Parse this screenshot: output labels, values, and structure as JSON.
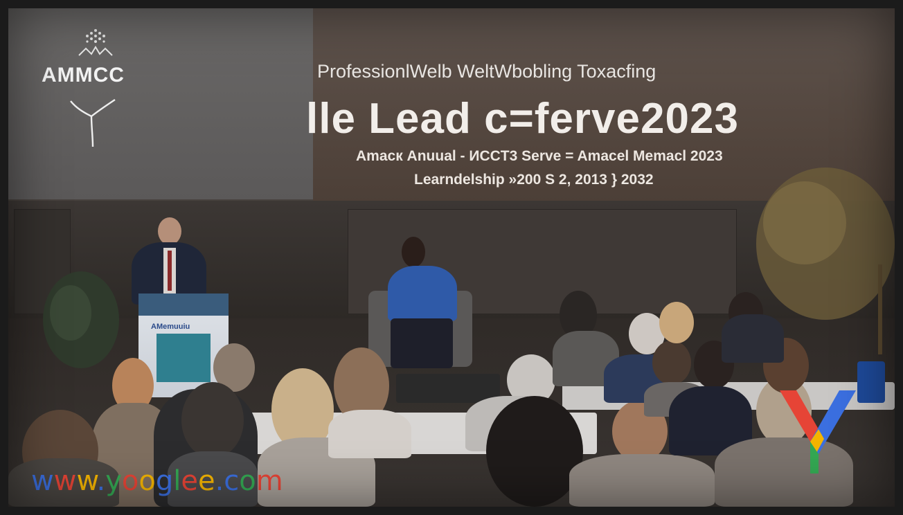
{
  "left_screen": {
    "logo_text": "AMMCC"
  },
  "banner": {
    "line1": "ProfessionlWelb WeltWbobling Toxacfing",
    "headline": "lle Lead c=ferve2023",
    "line3": "Amacк Anuual - ИCCT3 Serve = Amacel Memacl 2023",
    "line4": "Learndelship »200 S 2, 2013 } 2032"
  },
  "podium": {
    "label": "AMemuuiu"
  },
  "watermark": {
    "text": "www.yooglee.com",
    "letters": [
      {
        "ch": "w",
        "color": "#3b6fe0"
      },
      {
        "ch": "w",
        "color": "#e64436"
      },
      {
        "ch": "w",
        "color": "#f4b400"
      },
      {
        "ch": ".",
        "color": "#3b6fe0"
      },
      {
        "ch": "y",
        "color": "#34a853"
      },
      {
        "ch": "o",
        "color": "#e64436"
      },
      {
        "ch": "o",
        "color": "#f4b400"
      },
      {
        "ch": "g",
        "color": "#3b6fe0"
      },
      {
        "ch": "l",
        "color": "#34a853"
      },
      {
        "ch": "e",
        "color": "#e64436"
      },
      {
        "ch": "e",
        "color": "#f4b400"
      },
      {
        "ch": ".",
        "color": "#3b6fe0"
      },
      {
        "ch": "c",
        "color": "#3b6fe0"
      },
      {
        "ch": "o",
        "color": "#34a853"
      },
      {
        "ch": "m",
        "color": "#e64436"
      }
    ],
    "logo_colors": [
      "#e64436",
      "#3b6fe0",
      "#f4b400",
      "#34a853"
    ]
  }
}
